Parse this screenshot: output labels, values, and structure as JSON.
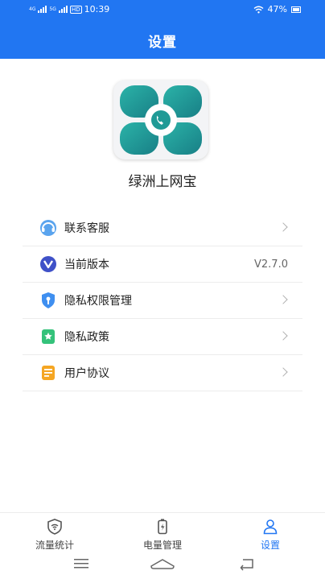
{
  "status": {
    "net1": "4G",
    "net2": "5G",
    "hd": "HD",
    "time": "10:39",
    "battery": "47%"
  },
  "header": {
    "title": "设置"
  },
  "app": {
    "name": "绿洲上网宝"
  },
  "menu": [
    {
      "label": "联系客服",
      "icon": "customer-service-icon",
      "value": ""
    },
    {
      "label": "当前版本",
      "icon": "version-icon",
      "value": "V2.7.0"
    },
    {
      "label": "隐私权限管理",
      "icon": "privacy-shield-icon",
      "value": ""
    },
    {
      "label": "隐私政策",
      "icon": "policy-icon",
      "value": ""
    },
    {
      "label": "用户协议",
      "icon": "agreement-icon",
      "value": ""
    }
  ],
  "tabs": [
    {
      "label": "流量统计",
      "icon": "shield-wifi-icon",
      "active": false
    },
    {
      "label": "电量管理",
      "icon": "battery-charge-icon",
      "active": false
    },
    {
      "label": "设置",
      "icon": "person-icon",
      "active": true
    }
  ],
  "colors": {
    "brand": "#2176f2",
    "teal": "#1f9a96",
    "orange": "#f5a623"
  }
}
